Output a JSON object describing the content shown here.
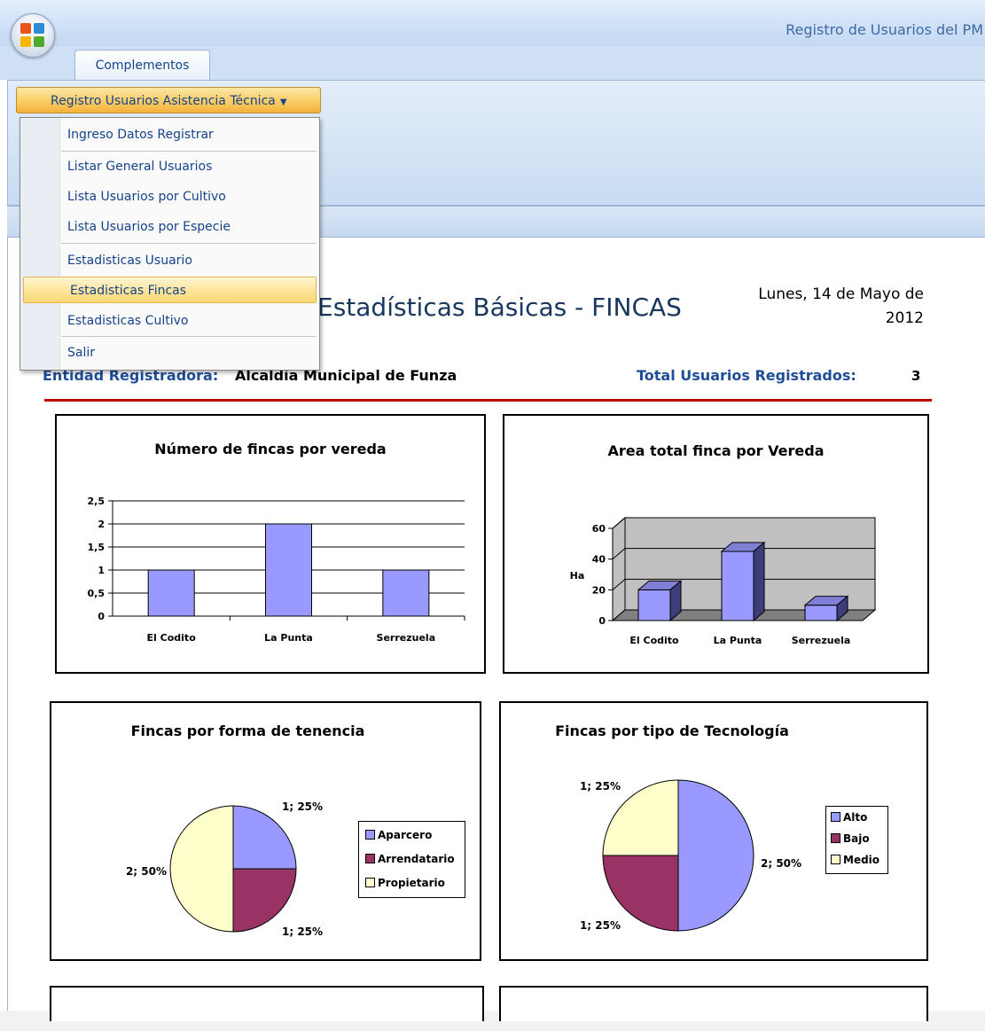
{
  "window": {
    "title": "Registro de Usuarios del PM"
  },
  "ribbon": {
    "tabs": [
      {
        "label": "Complementos"
      }
    ],
    "dropdown_button": {
      "label": "Registro Usuarios Asistencia Técnica"
    }
  },
  "menu": {
    "items": [
      {
        "label": "Ingreso Datos Registrar",
        "highlighted": false
      },
      {
        "label": "Listar General Usuarios",
        "highlighted": false
      },
      {
        "label": "Lista Usuarios por Cultivo",
        "highlighted": false
      },
      {
        "label": "Lista Usuarios por Especie",
        "highlighted": false
      },
      {
        "label": "Estadisticas Usuario",
        "highlighted": false
      },
      {
        "label": "Estadisticas Fincas",
        "highlighted": true
      },
      {
        "label": "Estadisticas Cultivo",
        "highlighted": false
      },
      {
        "label": "Salir",
        "highlighted": false
      }
    ]
  },
  "report": {
    "title": "Estadísticas Básicas - FINCAS",
    "date_line1": "Lunes, 14 de Mayo de",
    "date_line2": "2012",
    "entidad_label": "Entidad Registradora:",
    "entidad_value": "Alcaldía Municipal de Funza",
    "total_label": "Total Usuarios Registrados:",
    "total_value": "3"
  },
  "colors": {
    "bar": "#9999ff",
    "pie_periwinkle": "#9999ff",
    "pie_plum": "#993366",
    "pie_ivory": "#ffffcc",
    "accent_rule": "#c00000"
  },
  "chart_data": [
    {
      "type": "bar",
      "title": "Número de  fincas por vereda",
      "categories": [
        "El Codito",
        "La Punta",
        "Serrezuela"
      ],
      "values": [
        1,
        2,
        1
      ],
      "yticks": [
        "0",
        "0,5",
        "1",
        "1,5",
        "2",
        "2,5"
      ],
      "ylim": [
        0,
        2.5
      ],
      "grid": true
    },
    {
      "type": "bar",
      "title": "Area total finca por Vereda",
      "categories": [
        "El Codito",
        "La Punta",
        "Serrezuela"
      ],
      "values": [
        20,
        45,
        10
      ],
      "ylabel": "Ha",
      "yticks": [
        "0",
        "20",
        "40",
        "60"
      ],
      "ylim": [
        0,
        60
      ],
      "grid": true,
      "style": "3d"
    },
    {
      "type": "pie",
      "title": "Fincas por forma de tenencia",
      "slices": [
        {
          "name": "Aparcero",
          "value": 1,
          "label": "1; 25%",
          "color": "#9999ff"
        },
        {
          "name": "Arrendatario",
          "value": 1,
          "label": "1; 25%",
          "color": "#993366"
        },
        {
          "name": "Propietario",
          "value": 2,
          "label": "2; 50%",
          "color": "#ffffcc"
        }
      ],
      "legend": "right"
    },
    {
      "type": "pie",
      "title": "Fincas por tipo de Tecnología",
      "slices": [
        {
          "name": "Alto",
          "value": 2,
          "label": "2; 50%",
          "color": "#9999ff"
        },
        {
          "name": "Bajo",
          "value": 1,
          "label": "1; 25%",
          "color": "#993366"
        },
        {
          "name": "Medio",
          "value": 1,
          "label": "1; 25%",
          "color": "#ffffcc"
        }
      ],
      "legend": "right"
    }
  ]
}
